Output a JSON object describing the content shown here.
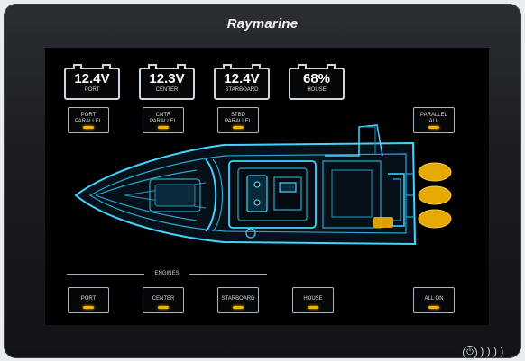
{
  "brand": "Raymarine",
  "batteries": [
    {
      "value": "12.4V",
      "label": "PORT"
    },
    {
      "value": "12.3V",
      "label": "CENTER"
    },
    {
      "value": "12.4V",
      "label": "STARBOARD"
    },
    {
      "value": "68%",
      "label": "HOUSE"
    }
  ],
  "parallel_buttons": [
    {
      "line1": "PORT",
      "line2": "PARALLEL"
    },
    {
      "line1": "CNTR",
      "line2": "PARALLEL"
    },
    {
      "line1": "STBD",
      "line2": "PARALLEL"
    }
  ],
  "parallel_all": {
    "line1": "PARALLEL",
    "line2": "ALL"
  },
  "engines_section_label": "ENGINES",
  "engine_buttons": [
    "PORT",
    "CENTER",
    "STARBOARD",
    "HOUSE"
  ],
  "all_on_label": "ALL ON",
  "power_glyph": "⏻",
  "power_arcs": ") ) ) )",
  "colors": {
    "indicator": "#f6b000",
    "hull_outline": "#43d3ff",
    "engine_glow": "#f2b300"
  }
}
